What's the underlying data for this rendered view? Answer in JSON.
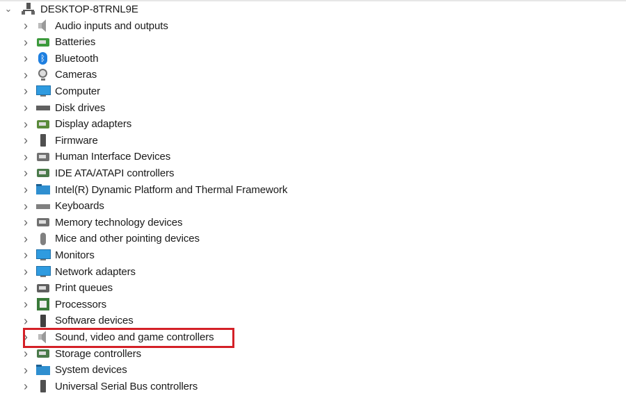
{
  "tree": {
    "root": {
      "label": "DESKTOP-8TRNL9E",
      "expanded": true,
      "icon": "computer-network-icon"
    },
    "items": [
      {
        "label": "Audio inputs and outputs",
        "icon": "speaker-icon",
        "color": "#9a9a9a"
      },
      {
        "label": "Batteries",
        "icon": "battery-icon",
        "color": "#3c9a3c"
      },
      {
        "label": "Bluetooth",
        "icon": "bluetooth-icon",
        "color": "#1e7fe0"
      },
      {
        "label": "Cameras",
        "icon": "camera-icon",
        "color": "#707070"
      },
      {
        "label": "Computer",
        "icon": "monitor-icon",
        "color": "#2f9be0"
      },
      {
        "label": "Disk drives",
        "icon": "disk-drive-icon",
        "color": "#606060"
      },
      {
        "label": "Display adapters",
        "icon": "display-adapter-icon",
        "color": "#5a8a3a"
      },
      {
        "label": "Firmware",
        "icon": "firmware-icon",
        "color": "#505050"
      },
      {
        "label": "Human Interface Devices",
        "icon": "hid-icon",
        "color": "#707070"
      },
      {
        "label": "IDE ATA/ATAPI controllers",
        "icon": "ide-controller-icon",
        "color": "#4a7a4a"
      },
      {
        "label": "Intel(R) Dynamic Platform and Thermal Framework",
        "icon": "folder-device-icon",
        "color": "#2f8fd0"
      },
      {
        "label": "Keyboards",
        "icon": "keyboard-icon",
        "color": "#808080"
      },
      {
        "label": "Memory technology devices",
        "icon": "memory-icon",
        "color": "#707070"
      },
      {
        "label": "Mice and other pointing devices",
        "icon": "mouse-icon",
        "color": "#808080"
      },
      {
        "label": "Monitors",
        "icon": "monitor-icon",
        "color": "#2f9be0"
      },
      {
        "label": "Network adapters",
        "icon": "network-adapter-icon",
        "color": "#2f9be0"
      },
      {
        "label": "Print queues",
        "icon": "printer-icon",
        "color": "#606060"
      },
      {
        "label": "Processors",
        "icon": "processor-icon",
        "color": "#3a7a3a"
      },
      {
        "label": "Software devices",
        "icon": "software-device-icon",
        "color": "#404040"
      },
      {
        "label": "Sound, video and game controllers",
        "icon": "speaker-icon",
        "color": "#9a9a9a",
        "highlighted": true
      },
      {
        "label": "Storage controllers",
        "icon": "storage-controller-icon",
        "color": "#4a7a4a"
      },
      {
        "label": "System devices",
        "icon": "folder-device-icon",
        "color": "#2f8fd0"
      },
      {
        "label": "Universal Serial Bus controllers",
        "icon": "usb-icon",
        "color": "#505050"
      }
    ]
  },
  "highlight_color": "#d42027"
}
